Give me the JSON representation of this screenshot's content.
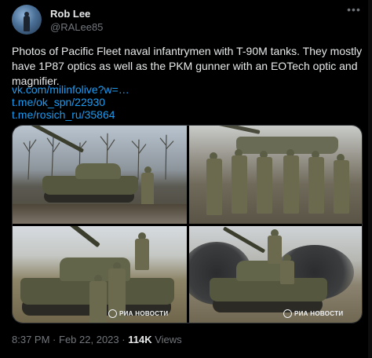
{
  "tweet": {
    "author_name": "Rob Lee",
    "author_handle": "@RALee85",
    "more_icon": "more-dots-icon",
    "body_text": "Photos of Pacific Fleet naval infantrymen with T-90M tanks. They mostly have 1P87 optics as well as the PKM gunner with an EOTech optic and magnifier.",
    "links": [
      "vk.com/milinfolive?w=…",
      "t.me/ok_spn/22930",
      "t.me/rosich_ru/35864"
    ],
    "watermarks": [
      "РИА НОВОСТИ",
      "РИА НОВОСТИ"
    ],
    "time": "8:37 PM",
    "separator": "·",
    "date": "Feb 22, 2023",
    "views_count": "114K",
    "views_label": "Views"
  },
  "colors": {
    "background": "#000000",
    "text": "#e7e9ea",
    "secondary": "#71767b",
    "link": "#1d9bf0"
  }
}
